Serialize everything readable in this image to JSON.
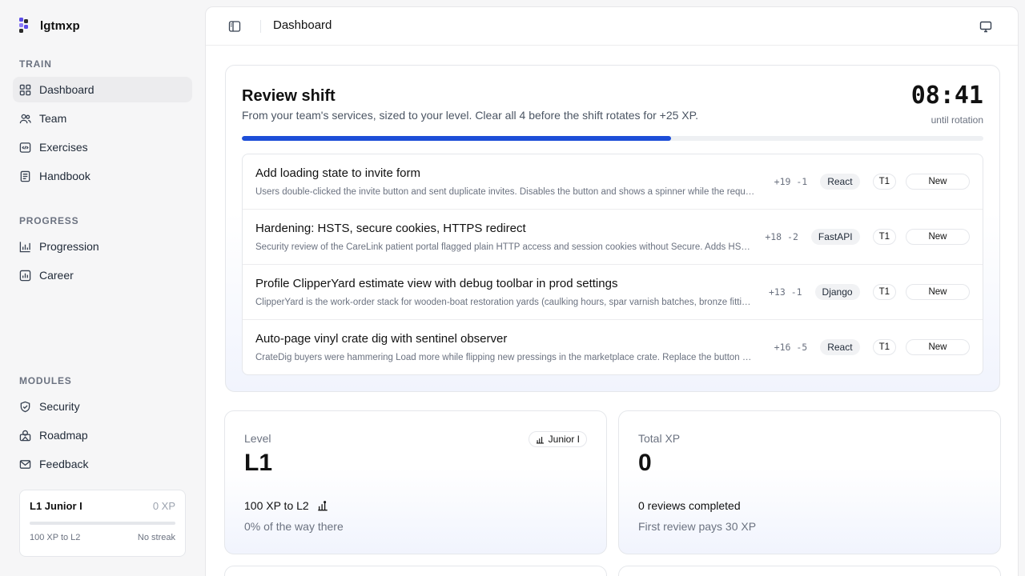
{
  "app": {
    "name": "lgtmxp"
  },
  "sidebar": {
    "sections": [
      {
        "label": "TRAIN",
        "items": [
          {
            "label": "Dashboard",
            "icon": "grid-icon",
            "active": true
          },
          {
            "label": "Team",
            "icon": "users-icon"
          },
          {
            "label": "Exercises",
            "icon": "code-file-icon"
          },
          {
            "label": "Handbook",
            "icon": "book-icon"
          }
        ]
      },
      {
        "label": "PROGRESS",
        "items": [
          {
            "label": "Progression",
            "icon": "bar-chart-icon"
          },
          {
            "label": "Career",
            "icon": "chart-box-icon"
          }
        ]
      },
      {
        "label": "MODULES",
        "items": [
          {
            "label": "Security",
            "icon": "shield-check-icon"
          },
          {
            "label": "Roadmap",
            "icon": "map-icon"
          },
          {
            "label": "Feedback",
            "icon": "mail-icon"
          }
        ]
      }
    ],
    "user_card": {
      "title": "L1 Junior I",
      "xp": "0 XP",
      "progress": 0,
      "to_next": "100 XP to L2",
      "streak": "No streak"
    }
  },
  "header": {
    "title": "Dashboard"
  },
  "shift": {
    "title": "Review shift",
    "subtitle": "From your team's services, sized to your level. Clear all 4 before the shift rotates for +25 XP.",
    "timer": "08:41",
    "timer_label": "until rotation",
    "progress_fraction": 0.579,
    "accent": "#1d4ed8",
    "tasks": [
      {
        "title": "Add loading state to invite form",
        "description": "Users double-clicked the invite button and sent duplicate invites. Disables the button and shows a spinner while the request is in flight.",
        "added": "+19",
        "removed": "-1",
        "stack": "React",
        "tier": "T1",
        "status": "New"
      },
      {
        "title": "Hardening: HSTS, secure cookies, HTTPS redirect",
        "description": "Security review of the CareLink patient portal flagged plain HTTP access and session cookies without Secure. Adds HSTS and redirects.",
        "added": "+18",
        "removed": "-2",
        "stack": "FastAPI",
        "tier": "T1",
        "status": "New"
      },
      {
        "title": "Profile ClipperYard estimate view with debug toolbar in prod settings",
        "description": "ClipperYard is the work-order stack for wooden-boat restoration yards (caulking hours, spar varnish batches, bronze fittings).",
        "added": "+13",
        "removed": "-1",
        "stack": "Django",
        "tier": "T1",
        "status": "New"
      },
      {
        "title": "Auto-page vinyl crate dig with sentinel observer",
        "description": "CrateDig buyers were hammering Load more while flipping new pressings in the marketplace crate. Replace the button with a sentinel.",
        "added": "+16",
        "removed": "-5",
        "stack": "React",
        "tier": "T1",
        "status": "New"
      }
    ]
  },
  "level_card": {
    "label": "Level",
    "value": "L1",
    "badge": "Junior I",
    "to_next": "100 XP to L2",
    "percent_text": "0% of the way there"
  },
  "xp_card": {
    "label": "Total XP",
    "value": "0",
    "reviews": "0 reviews completed",
    "hint": "First review pays 30 XP"
  }
}
